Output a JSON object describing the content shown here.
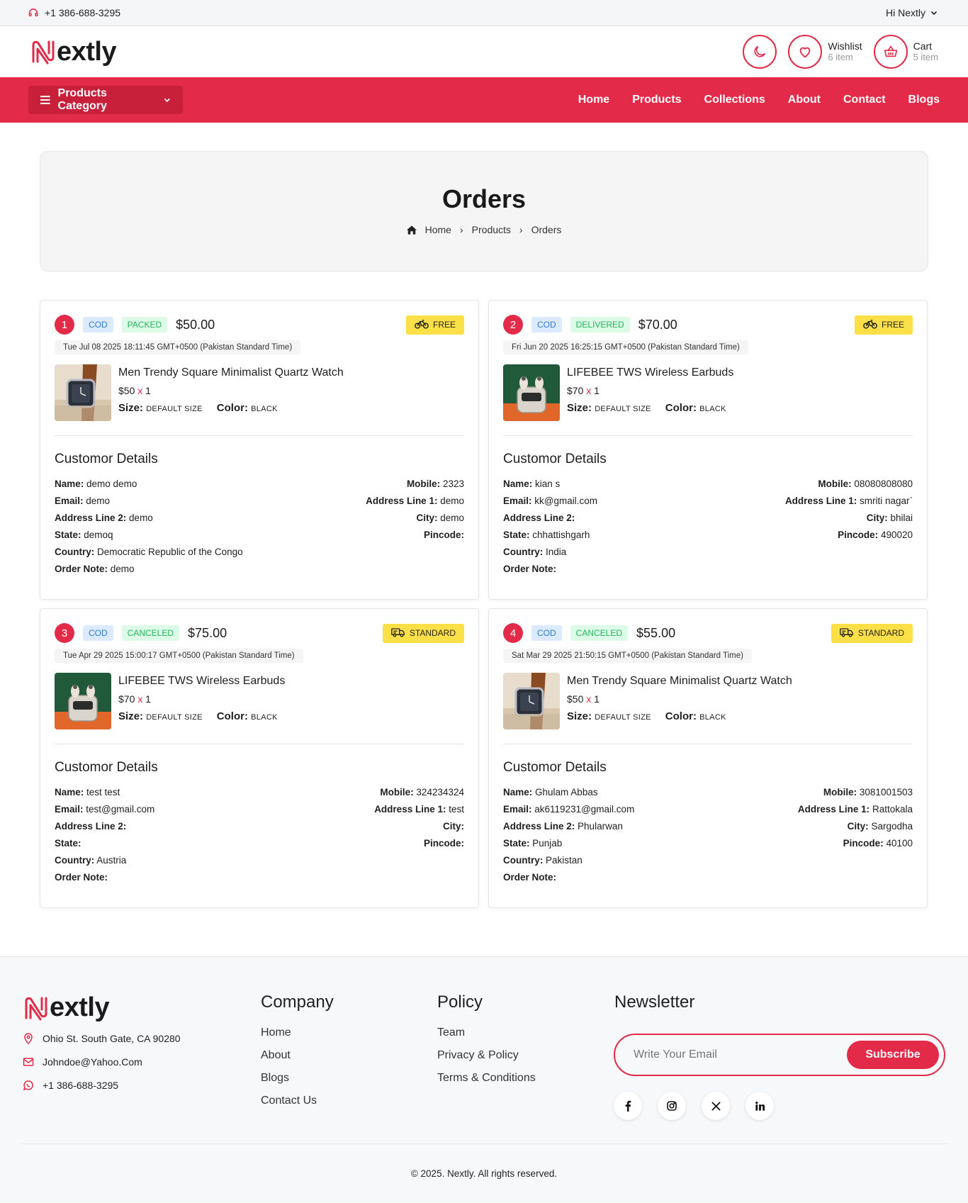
{
  "topbar": {
    "phone": "+1 386-688-3295",
    "greeting": "Hi Nextly"
  },
  "brand": {
    "logo_text": "extly",
    "accent": "#e32a48"
  },
  "header": {
    "wishlist_label": "Wishlist",
    "wishlist_count": "6 item",
    "cart_label": "Cart",
    "cart_count": "5 item"
  },
  "nav": {
    "category_label": "Products Category",
    "links": [
      "Home",
      "Products",
      "Collections",
      "About",
      "Contact",
      "Blogs"
    ]
  },
  "hero": {
    "title": "Orders",
    "breadcrumb": [
      "Home",
      "Products",
      "Orders"
    ]
  },
  "orders": [
    {
      "num": "1",
      "payment": "COD",
      "status": "PACKED",
      "price": "$50.00",
      "shipping": "FREE",
      "date": "Tue Jul 08 2025 18:11:45 GMT+0500 (Pakistan Standard Time)",
      "product": "Men Trendy Square Minimalist Quartz Watch",
      "unit": "$50",
      "x": "x",
      "qty": "1",
      "size": "DEFAULT SIZE",
      "color": "BLACK",
      "customer": {
        "name": "demo demo",
        "email": "demo",
        "addr2": "demo",
        "state": "demoq",
        "country": "Democratic Republic of the Congo",
        "note": "demo",
        "mobile": "2323",
        "addr1": "demo",
        "city": "demo",
        "pincode": ""
      }
    },
    {
      "num": "2",
      "payment": "COD",
      "status": "DELIVERED",
      "price": "$70.00",
      "shipping": "FREE",
      "date": "Fri Jun 20 2025 16:25:15 GMT+0500 (Pakistan Standard Time)",
      "product": "LIFEBEE TWS Wireless Earbuds",
      "unit": "$70",
      "x": "x",
      "qty": "1",
      "size": "DEFAULT SIZE",
      "color": "BLACK",
      "customer": {
        "name": "kian s",
        "email": "kk@gmail.com",
        "addr2": "",
        "state": "chhattishgarh",
        "country": "India",
        "note": "",
        "mobile": "08080808080",
        "addr1": "smriti nagar`",
        "city": "bhilai",
        "pincode": "490020"
      }
    },
    {
      "num": "3",
      "payment": "COD",
      "status": "CANCELED",
      "price": "$75.00",
      "shipping": "STANDARD",
      "date": "Tue Apr 29 2025 15:00:17 GMT+0500 (Pakistan Standard Time)",
      "product": "LIFEBEE TWS Wireless Earbuds",
      "unit": "$70",
      "x": "x",
      "qty": "1",
      "size": "DEFAULT SIZE",
      "color": "BLACK",
      "customer": {
        "name": "test test",
        "email": "test@gmail.com",
        "addr2": "",
        "state": "",
        "country": "Austria",
        "note": "",
        "mobile": "324234324",
        "addr1": "test",
        "city": "",
        "pincode": ""
      }
    },
    {
      "num": "4",
      "payment": "COD",
      "status": "CANCELED",
      "price": "$55.00",
      "shipping": "STANDARD",
      "date": "Sat Mar 29 2025 21:50:15 GMT+0500 (Pakistan Standard Time)",
      "product": "Men Trendy Square Minimalist Quartz Watch",
      "unit": "$50",
      "x": "x",
      "qty": "1",
      "size": "DEFAULT SIZE",
      "color": "BLACK",
      "customer": {
        "name": "Ghulam Abbas",
        "email": "ak6119231@gmail.com",
        "addr2": "Phularwan",
        "state": "Punjab",
        "country": "Pakistan",
        "note": "",
        "mobile": "3081001503",
        "addr1": "Rattokala",
        "city": "Sargodha",
        "pincode": "40100"
      }
    }
  ],
  "labels": {
    "customer_heading": "Customor Details",
    "size": "Size:",
    "color": "Color:",
    "name": "Name:",
    "email": "Email:",
    "addr2": "Address Line 2:",
    "state": "State:",
    "country": "Country:",
    "note": "Order Note:",
    "mobile": "Mobile:",
    "addr1": "Address Line 1:",
    "city": "City:",
    "pincode": "Pincode:"
  },
  "footer": {
    "address": "Ohio St. South Gate, CA 90280",
    "email": "Johndoe@Yahoo.Com",
    "phone": "+1 386-688-3295",
    "company_title": "Company",
    "company_links": [
      "Home",
      "About",
      "Blogs",
      "Contact Us"
    ],
    "policy_title": "Policy",
    "policy_links": [
      "Team",
      "Privacy & Policy",
      "Terms & Conditions"
    ],
    "newsletter_title": "Newsletter",
    "newsletter_placeholder": "Write Your Email",
    "subscribe_label": "Subscribe",
    "social_icons": [
      "facebook-icon",
      "instagram-icon",
      "x-icon",
      "linkedin-icon"
    ],
    "copyright": "© 2025. Nextly. All rights reserved."
  }
}
